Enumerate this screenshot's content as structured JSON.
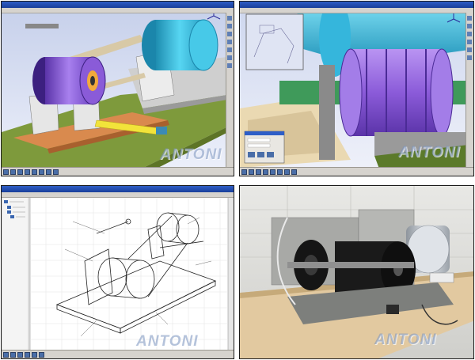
{
  "watermark": {
    "text": "ANTONI"
  },
  "panels": [
    {
      "id": "cad-assembly-view",
      "app": "CATIA",
      "view": "3D model of the test bench assembly"
    },
    {
      "id": "cad-section-view",
      "app": "CATIA",
      "view": "Cutaway of the rotor assembly with a dialog"
    },
    {
      "id": "cad-drawing-view",
      "app": "CATIA",
      "view": "Isometric line drawing with tree panel"
    },
    {
      "id": "photo-bench",
      "app": "Photo",
      "view": "Built test bench"
    }
  ],
  "colors": {
    "cad_background_top": "#c8d2ec",
    "cad_background_bottom": "#eef1fb",
    "drum_cyan": "#3fc6e6",
    "rotor_purple": "#8b5bd9",
    "base_green": "#7e9a3c",
    "rail_orange": "#d98a4e",
    "yellow_bar": "#f2e33a",
    "window_blue": "#1d4fb3"
  },
  "icons": [
    "cad-toolbar-icon",
    "camera-icon",
    "compass-icon",
    "tree-icon"
  ]
}
